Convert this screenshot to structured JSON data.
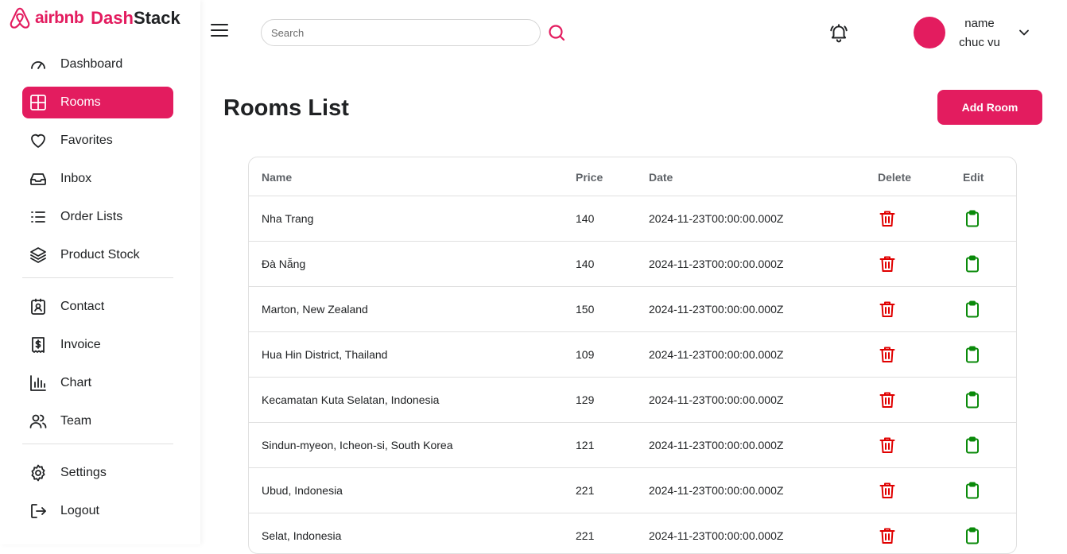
{
  "logo": {
    "brand": "airbnb",
    "dash": "Dash",
    "stack": "Stack"
  },
  "sidebar": {
    "items": [
      {
        "label": "Dashboard",
        "icon": "dashboard-gauge-icon"
      },
      {
        "label": "Rooms",
        "icon": "grid-icon",
        "active": true
      },
      {
        "label": "Favorites",
        "icon": "heart-icon"
      },
      {
        "label": "Inbox",
        "icon": "inbox-icon"
      },
      {
        "label": "Order Lists",
        "icon": "list-icon"
      },
      {
        "label": "Product Stock",
        "icon": "layers-icon"
      },
      {
        "label": "Contact",
        "icon": "contact-icon"
      },
      {
        "label": "Invoice",
        "icon": "invoice-icon"
      },
      {
        "label": "Chart",
        "icon": "bar-chart-icon"
      },
      {
        "label": "Team",
        "icon": "team-icon"
      },
      {
        "label": "Settings",
        "icon": "gear-icon"
      },
      {
        "label": "Logout",
        "icon": "logout-icon"
      }
    ]
  },
  "header": {
    "search_placeholder": "Search",
    "search_value": "",
    "user_name": "name",
    "user_role": "chuc vu"
  },
  "main": {
    "title": "Rooms List",
    "add_button": "Add Room",
    "columns": [
      "Name",
      "Price",
      "Date",
      "Delete",
      "Edit"
    ],
    "rows": [
      {
        "name": "Nha Trang",
        "price": "140",
        "date": "2024-11-23T00:00:00.000Z"
      },
      {
        "name": "Đà Nẵng",
        "price": "140",
        "date": "2024-11-23T00:00:00.000Z"
      },
      {
        "name": "Marton, New Zealand",
        "price": "150",
        "date": "2024-11-23T00:00:00.000Z"
      },
      {
        "name": "Hua Hin District, Thailand",
        "price": "109",
        "date": "2024-11-23T00:00:00.000Z"
      },
      {
        "name": "Kecamatan Kuta Selatan, Indonesia",
        "price": "129",
        "date": "2024-11-23T00:00:00.000Z"
      },
      {
        "name": "Sindun-myeon, Icheon-si, South Korea",
        "price": "121",
        "date": "2024-11-23T00:00:00.000Z"
      },
      {
        "name": "Ubud, Indonesia",
        "price": "221",
        "date": "2024-11-23T00:00:00.000Z"
      },
      {
        "name": "Selat, Indonesia",
        "price": "221",
        "date": "2024-11-23T00:00:00.000Z"
      }
    ]
  },
  "colors": {
    "accent": "#e31c5f",
    "delete": "#e00000",
    "edit": "#0a8a0a",
    "text": "#202224"
  }
}
